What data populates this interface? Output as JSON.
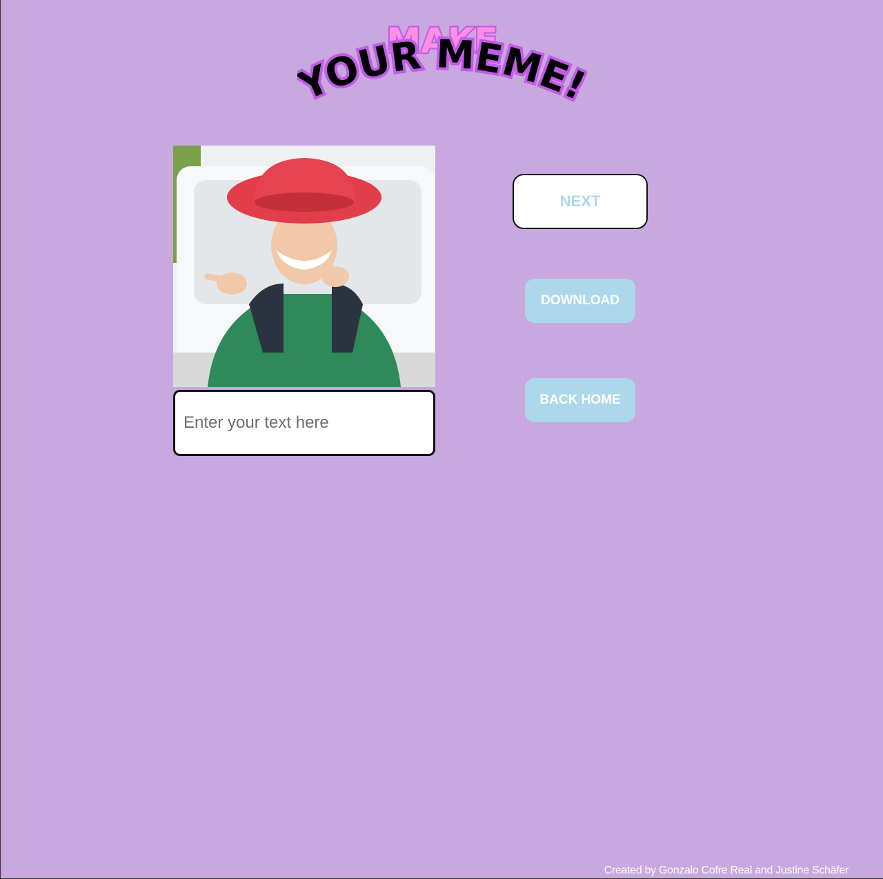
{
  "logo": {
    "line1": "MAKE",
    "line2": "YOUR MEME!",
    "colors": {
      "pink": "#ff8fe5",
      "outline": "#c25be8",
      "black": "#000000"
    }
  },
  "editor": {
    "image_alt": "photo-of-smiling-person-in-red-hat-and-green-hoodie",
    "text_input": {
      "placeholder": "Enter your text here",
      "value": ""
    }
  },
  "actions": {
    "next_label": "NEXT",
    "download_label": "DOWNLOAD",
    "back_home_label": "BACK HOME"
  },
  "footer": {
    "credit": "Created by Gonzalo Cofre Real and Justine Schäfer"
  },
  "theme": {
    "background": "#c8a8de",
    "button_blue": "#add8ec"
  }
}
